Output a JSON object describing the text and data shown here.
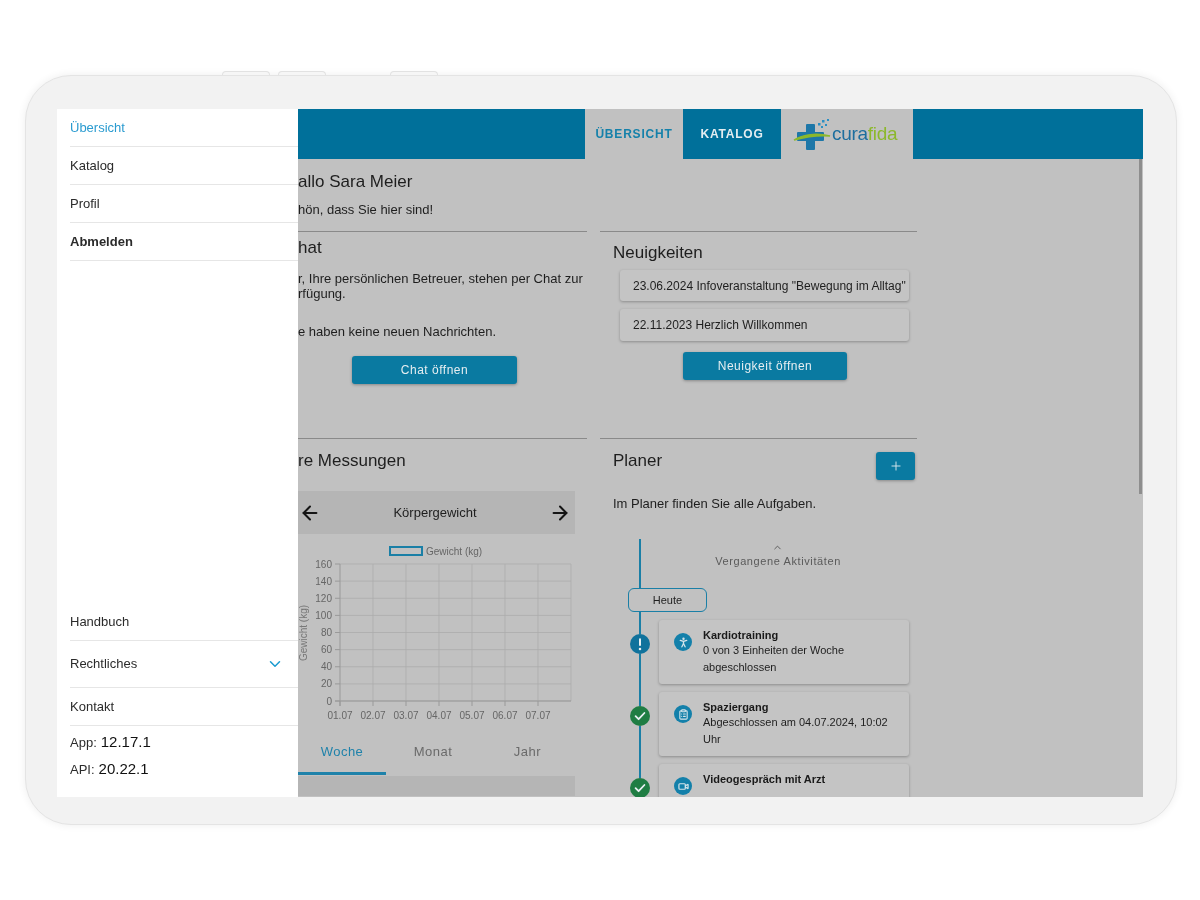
{
  "drawer": {
    "items": [
      {
        "label": "Übersicht",
        "selected": true,
        "bold": false
      },
      {
        "label": "Katalog",
        "selected": false,
        "bold": false
      },
      {
        "label": "Profil",
        "selected": false,
        "bold": false
      },
      {
        "label": "Abmelden",
        "selected": false,
        "bold": true
      }
    ],
    "footer_items": [
      {
        "kind": "link",
        "label": "Handbuch"
      },
      {
        "kind": "expandable",
        "label": "Rechtliches",
        "expanded": false
      },
      {
        "kind": "link",
        "label": "Kontakt"
      }
    ],
    "versions": [
      {
        "label": "App:",
        "value": "12.17.1"
      },
      {
        "label": "API:",
        "value": "20.22.1"
      }
    ]
  },
  "header": {
    "tabs": [
      {
        "label": "ÜBERSICHT",
        "selected": true
      },
      {
        "label": "KATALOG",
        "selected": false
      }
    ],
    "logo": [
      {
        "text": "cura",
        "color": "#1d6e9e"
      },
      {
        "text": "fida",
        "color": "#8cb82c"
      }
    ]
  },
  "greeting": {
    "title": "allo Sara Meier",
    "subtitle": "hön, dass Sie hier sind!"
  },
  "chat": {
    "title": "hat",
    "description": [
      "r, Ihre persönlichen Betreuer, stehen per Chat zur",
      "rfügung."
    ],
    "status": "e haben keine neuen Nachrichten.",
    "button": "Chat öffnen"
  },
  "news": {
    "title": "Neuigkeiten",
    "items": [
      "23.06.2024 Infoveranstaltung \"Bewegung im Alltag\"",
      "22.11.2023 Herzlich Willkommen"
    ],
    "button": "Neuigkeit öffnen"
  },
  "measurements": {
    "title": "re Messungen",
    "chart_data": {
      "type": "line",
      "title": "Körpergewicht",
      "ylabel": "Gewicht (kg)",
      "categories": [
        "01.07",
        "02.07",
        "03.07",
        "04.07",
        "05.07",
        "06.07",
        "07.07"
      ],
      "series": [
        {
          "name": "Gewicht (kg)",
          "color": "#1a7fa6",
          "values": [
            null,
            null,
            null,
            null,
            null,
            null,
            null
          ]
        }
      ],
      "ylim": [
        0,
        160
      ],
      "yticks": [
        0,
        20,
        40,
        60,
        80,
        100,
        120,
        140,
        160
      ],
      "grid": true
    },
    "periods": [
      {
        "label": "Woche",
        "selected": true
      },
      {
        "label": "Monat",
        "selected": false
      },
      {
        "label": "Jahr",
        "selected": false
      }
    ]
  },
  "planner": {
    "title": "Planer",
    "description": "Im Planer finden Sie alle Aufgaben.",
    "past_label": "Vergangene Aktivitäten",
    "today_label": "Heute",
    "activities": [
      {
        "kind": "exercise",
        "completed": false,
        "title": "Kardiotraining",
        "detail": "0 von 3 Einheiten der Woche abgeschlossen"
      },
      {
        "kind": "checklist",
        "completed": true,
        "title": "Spaziergang",
        "detail": "Abgeschlossen am 04.07.2024, 10:02 Uhr"
      },
      {
        "kind": "video",
        "completed": true,
        "title": "Videogespräch mit Arzt"
      }
    ]
  }
}
